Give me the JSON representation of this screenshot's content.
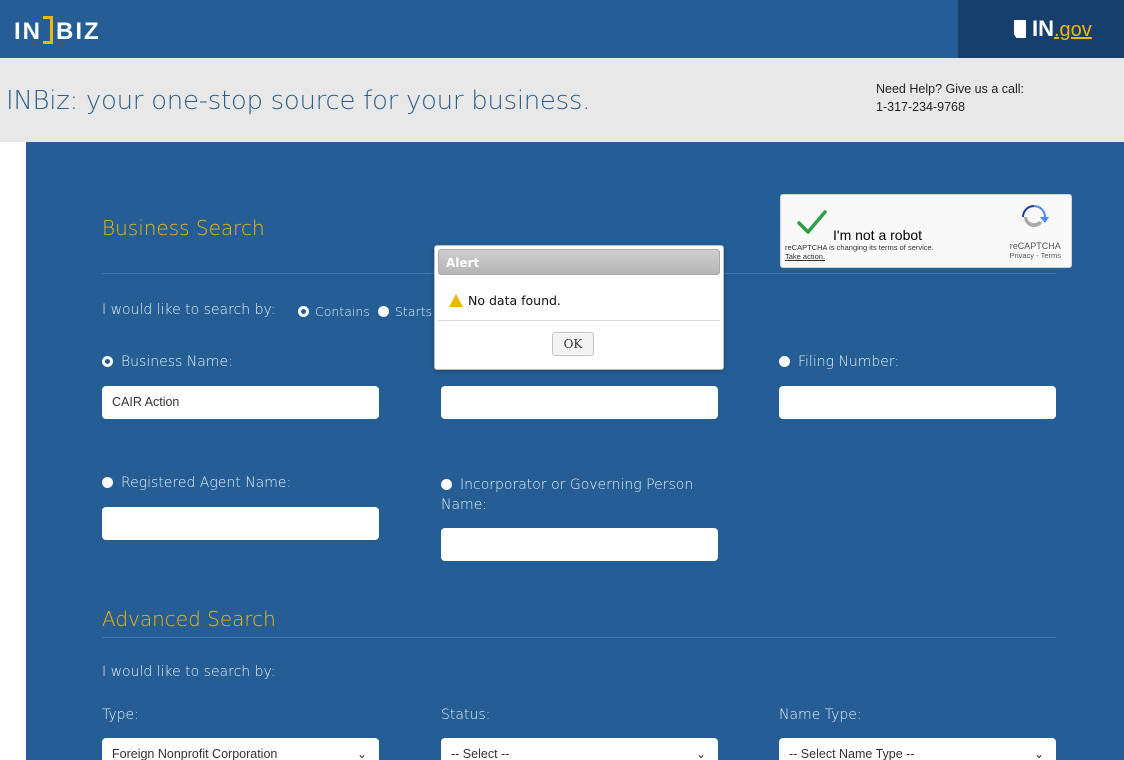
{
  "header": {
    "logo_left": "IN",
    "logo_right": "BIZ",
    "ingov_in": "IN",
    "ingov_gov": ".gov"
  },
  "banner": {
    "tagline": "INBiz: your one-stop source for your business.",
    "help_line1": "Need Help? Give us a call:",
    "help_line2": "1-317-234-9768"
  },
  "business_search": {
    "title": "Business Search",
    "search_by_label": "I would like to search by:",
    "match_options": [
      {
        "label": "Contains",
        "selected": true
      },
      {
        "label": "Starts",
        "selected": false
      }
    ],
    "fields": {
      "business_name": {
        "label": "Business Name:",
        "value": "CAIR Action",
        "selected": true
      },
      "filing_number": {
        "label": "Filing Number:",
        "value": "",
        "selected": false
      },
      "registered_agent": {
        "label": "Registered Agent Name:",
        "value": "",
        "selected": false
      },
      "incorporator": {
        "label": "Incorporator or Governing Person Name:",
        "value": "",
        "selected": false
      }
    }
  },
  "advanced_search": {
    "title": "Advanced Search",
    "search_by_label": "I would like to search by:",
    "type_label": "Type:",
    "type_value": "Foreign Nonprofit Corporation",
    "status_label": "Status:",
    "status_value": "-- Select --",
    "name_type_label": "Name Type:",
    "name_type_value": "-- Select Name Type --"
  },
  "recaptcha": {
    "label": "I'm not a robot",
    "terms_line": "reCAPTCHA is changing its terms of service.",
    "take_action": "Take action.",
    "brand": "reCAPTCHA",
    "privacy_terms": "Privacy - Terms"
  },
  "alert": {
    "title": "Alert",
    "message": "No data found.",
    "ok_label": "OK"
  },
  "colors": {
    "panel": "#245e95",
    "accent": "#f2b705"
  }
}
